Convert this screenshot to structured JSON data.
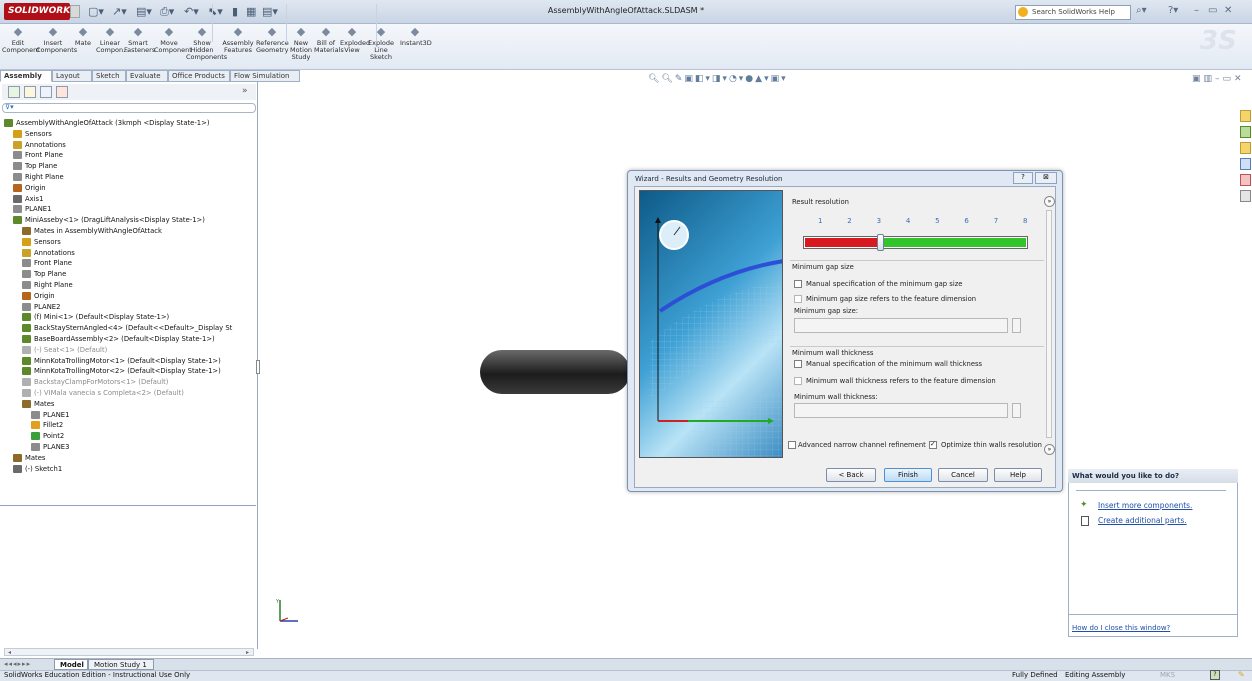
{
  "app": {
    "logo": "SOLIDWORKS",
    "document_title": "AssemblyWithAngleOfAttack.SLDASM *",
    "help_search_placeholder": "Search SolidWorks Help"
  },
  "ribbon": [
    {
      "label": "Edit\nComponent",
      "icon": "edit-component-icon"
    },
    {
      "label": "Insert\nComponents",
      "icon": "insert-components-icon"
    },
    {
      "label": "Mate",
      "icon": "mate-icon"
    },
    {
      "label": "Linear\nCompon...",
      "icon": "linear-pattern-icon"
    },
    {
      "label": "Smart\nFasteners",
      "icon": "smart-fasteners-icon"
    },
    {
      "label": "Move\nComponent",
      "icon": "move-component-icon"
    },
    {
      "label": "Show\nHidden\nComponents",
      "icon": "show-hidden-icon"
    },
    {
      "label": "Assembly\nFeatures",
      "icon": "assembly-features-icon"
    },
    {
      "label": "Reference\nGeometry",
      "icon": "reference-geometry-icon"
    },
    {
      "label": "New\nMotion\nStudy",
      "icon": "motion-study-icon"
    },
    {
      "label": "Bill of\nMaterials",
      "icon": "bom-icon"
    },
    {
      "label": "Exploded\nView",
      "icon": "exploded-view-icon"
    },
    {
      "label": "Explode\nLine\nSketch",
      "icon": "explode-line-icon"
    },
    {
      "label": "Instant3D",
      "icon": "instant3d-icon"
    }
  ],
  "tabs": [
    "Assembly",
    "Layout",
    "Sketch",
    "Evaluate",
    "Office Products",
    "Flow Simulation"
  ],
  "tree": [
    {
      "text": "AssemblyWithAngleOfAttack  (3kmph <Display State-1>)",
      "indent": 0,
      "icon": "assembly-icon",
      "color": "#5c8a2b"
    },
    {
      "text": "Sensors",
      "indent": 1,
      "icon": "sensors-icon",
      "color": "#d4a017"
    },
    {
      "text": "Annotations",
      "indent": 1,
      "icon": "annotations-icon",
      "color": "#c9a227"
    },
    {
      "text": "Front Plane",
      "indent": 1,
      "icon": "plane-icon",
      "color": "#8c8c8c"
    },
    {
      "text": "Top Plane",
      "indent": 1,
      "icon": "plane-icon",
      "color": "#8c8c8c"
    },
    {
      "text": "Right Plane",
      "indent": 1,
      "icon": "plane-icon",
      "color": "#8c8c8c"
    },
    {
      "text": "Origin",
      "indent": 1,
      "icon": "origin-icon",
      "color": "#b5651d"
    },
    {
      "text": "Axis1",
      "indent": 1,
      "icon": "axis-icon",
      "color": "#6a6a6a"
    },
    {
      "text": "PLANE1",
      "indent": 1,
      "icon": "plane-icon",
      "color": "#8c8c8c"
    },
    {
      "text": "MiniAsseby<1> (DragLiftAnalysis<Display State-1>)",
      "indent": 1,
      "icon": "subassembly-icon",
      "color": "#5c8a2b"
    },
    {
      "text": "Mates in AssemblyWithAngleOfAttack",
      "indent": 2,
      "icon": "mates-icon",
      "color": "#8c6b2a"
    },
    {
      "text": "Sensors",
      "indent": 2,
      "icon": "sensors-icon",
      "color": "#d4a017"
    },
    {
      "text": "Annotations",
      "indent": 2,
      "icon": "annotations-icon",
      "color": "#c9a227"
    },
    {
      "text": "Front Plane",
      "indent": 2,
      "icon": "plane-icon",
      "color": "#8c8c8c"
    },
    {
      "text": "Top Plane",
      "indent": 2,
      "icon": "plane-icon",
      "color": "#8c8c8c"
    },
    {
      "text": "Right Plane",
      "indent": 2,
      "icon": "plane-icon",
      "color": "#8c8c8c"
    },
    {
      "text": "Origin",
      "indent": 2,
      "icon": "origin-icon",
      "color": "#b5651d"
    },
    {
      "text": "PLANE2",
      "indent": 2,
      "icon": "plane-icon",
      "color": "#8c8c8c"
    },
    {
      "text": "(f) Mini<1> (Default<Display State-1>)",
      "indent": 2,
      "icon": "subassembly-icon",
      "color": "#5c8a2b"
    },
    {
      "text": "BackStaySternAngled<4> (Default<<Default>_Display St",
      "indent": 2,
      "icon": "subassembly-icon",
      "color": "#5c8a2b"
    },
    {
      "text": "BaseBoardAssembly<2> (Default<Display State-1>)",
      "indent": 2,
      "icon": "subassembly-icon",
      "color": "#5c8a2b"
    },
    {
      "text": "(-) Seat<1> (Default)",
      "indent": 2,
      "icon": "part-icon",
      "color": "#b0b0b0",
      "grey": true
    },
    {
      "text": "MinnKotaTrollingMotor<1> (Default<Display State-1>)",
      "indent": 2,
      "icon": "subassembly-icon",
      "color": "#5c8a2b"
    },
    {
      "text": "MinnKotaTrollingMotor<2> (Default<Display State-1>)",
      "indent": 2,
      "icon": "subassembly-icon",
      "color": "#5c8a2b"
    },
    {
      "text": "BackstayClampForMotors<1> (Default)",
      "indent": 2,
      "icon": "part-icon",
      "color": "#b0b0b0",
      "grey": true
    },
    {
      "text": "(-) VIMala vanecia s Completa<2> (Default)",
      "indent": 2,
      "icon": "part-icon",
      "color": "#b0b0b0",
      "grey": true
    },
    {
      "text": "Mates",
      "indent": 2,
      "icon": "mates-icon",
      "color": "#8c6b2a"
    },
    {
      "text": "PLANE1",
      "indent": 3,
      "icon": "plane-icon",
      "color": "#8c8c8c"
    },
    {
      "text": "Fillet2",
      "indent": 3,
      "icon": "fillet-icon",
      "color": "#e0a020"
    },
    {
      "text": "Point2",
      "indent": 3,
      "icon": "point-icon",
      "color": "#3aa03a"
    },
    {
      "text": "PLANE3",
      "indent": 3,
      "icon": "plane-icon",
      "color": "#8c8c8c"
    },
    {
      "text": "Mates",
      "indent": 1,
      "icon": "mates-icon",
      "color": "#8c6b2a"
    },
    {
      "text": "(-) Sketch1",
      "indent": 1,
      "icon": "sketch-icon",
      "color": "#6a6a6a"
    }
  ],
  "bottom_tabs": [
    "Model",
    "Motion Study 1"
  ],
  "status": {
    "left": "SolidWorks Education Edition - Instructional Use Only",
    "defined": "Fully Defined",
    "mode": "Editing Assembly",
    "units": "MKS"
  },
  "dialog": {
    "title": "Wizard - Results and Geometry Resolution",
    "result_resolution_label": "Result resolution",
    "resolution_ticks": [
      "1",
      "2",
      "3",
      "4",
      "5",
      "6",
      "7",
      "8"
    ],
    "resolution_value": 3,
    "min_gap_title": "Minimum gap size",
    "min_gap_manual": "Manual specification of the minimum gap size",
    "min_gap_feature": "Minimum gap size refers to the feature dimension",
    "min_gap_field_label": "Minimum gap size:",
    "min_wall_title": "Minimum wall thickness",
    "min_wall_manual": "Manual specification of the minimum wall thickness",
    "min_wall_feature": "Minimum wall thickness refers to the feature dimension",
    "min_wall_field_label": "Minimum wall thickness:",
    "advanced_narrow": "Advanced narrow channel refinement",
    "optimize_thin": "Optimize thin walls resolution",
    "buttons": {
      "back": "< Back",
      "finish": "Finish",
      "cancel": "Cancel",
      "help": "Help"
    },
    "help_glyph": "?",
    "close_glyph": "⊠"
  },
  "taskpane": {
    "title": "What would you like to do?",
    "link1": "Insert more components.",
    "link2": "Create additional parts.",
    "footer_link": "How do I close this window?"
  }
}
